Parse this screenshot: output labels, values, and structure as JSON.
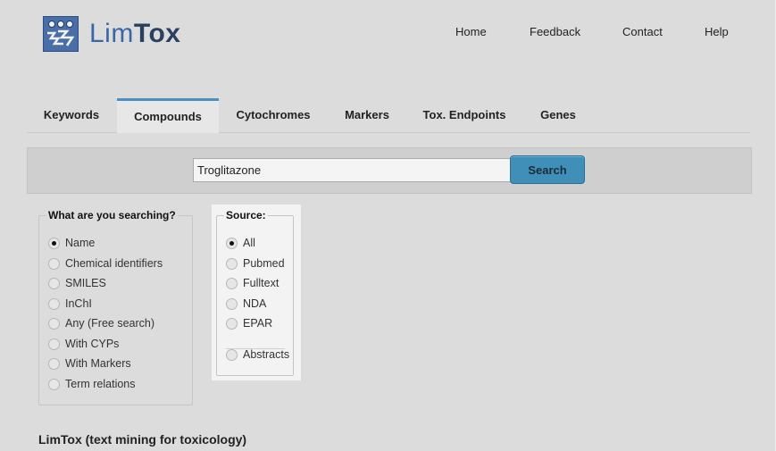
{
  "header": {
    "logo_text_prefix": "Lim",
    "logo_text_suffix": "Tox",
    "nav": [
      "Home",
      "Feedback",
      "Contact",
      "Help"
    ]
  },
  "tabs": [
    "Keywords",
    "Compounds",
    "Cytochromes",
    "Markers",
    "Tox. Endpoints",
    "Genes"
  ],
  "active_tab": "Compounds",
  "search": {
    "value": "Troglitazone",
    "button_label": "Search"
  },
  "searching": {
    "legend": "What are you searching?",
    "options": [
      "Name",
      "Chemical identifiers",
      "SMILES",
      "InChI",
      "Any (Free search)",
      "With CYPs",
      "With Markers",
      "Term relations"
    ],
    "selected": "Name"
  },
  "source": {
    "legend": "Source:",
    "options": [
      "All",
      "Pubmed",
      "Fulltext",
      "NDA",
      "EPAR",
      "Abstracts"
    ],
    "selected": "All"
  },
  "footer": {
    "title": "LimTox (text mining for toxicology)"
  },
  "colors": {
    "accent": "#3f8fb8",
    "logo_blue": "#3a66a8",
    "background": "#dcdcdc"
  },
  "icons": [
    "limtox-logo-icon"
  ]
}
